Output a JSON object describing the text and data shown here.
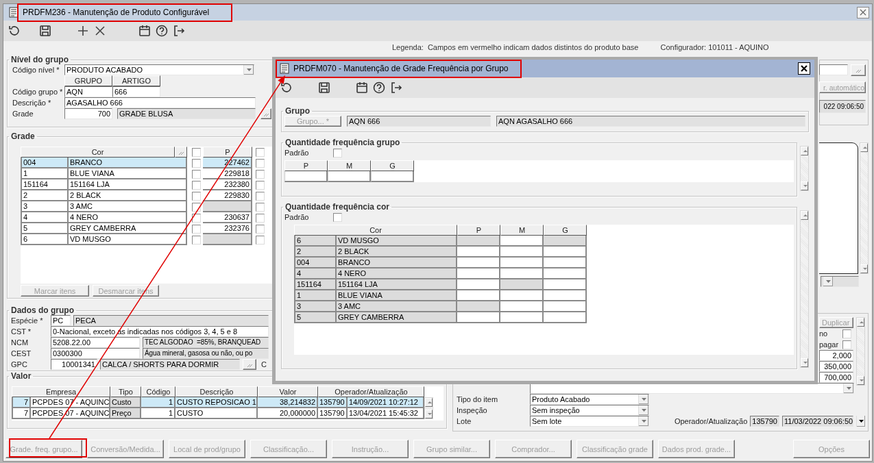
{
  "window": {
    "title": "PRDFM236 - Manutenção de Produto Configurável",
    "legend_label": "Legenda:",
    "legend_text": "Campos em vermelho indicam dados distintos do produto base",
    "configurador": "Configurador: 101011 - AQUINO",
    "nivel": {
      "title": "Nível do grupo",
      "codigo_nivel": {
        "label": "Código nível *",
        "value": "PRODUTO ACABADO"
      },
      "columns": [
        "GRUPO",
        "ARTIGO"
      ],
      "codigo_grupo": {
        "label": "Código grupo *",
        "grupo": "AQN",
        "artigo": "666"
      },
      "descricao": {
        "label": "Descrição *",
        "value": "AGASALHO 666"
      },
      "grade": {
        "label": "Grade",
        "code": "700",
        "name": "GRADE BLUSA"
      }
    },
    "nivel_side": {
      "button": {
        "label": "r. automático",
        "disabled": true
      },
      "date": "022 09:06:50"
    },
    "grade": {
      "title": "Grade",
      "columns": [
        "Cor",
        "P"
      ],
      "header_checked": [
        false,
        false
      ],
      "rows": [
        {
          "code": "004",
          "cor": "BRANCO",
          "checked": false,
          "p": "227462",
          "p_disabled": false,
          "checked_2": false,
          "selected": true
        },
        {
          "code": "1",
          "cor": "BLUE VIANA",
          "checked": false,
          "p": "229818",
          "p_disabled": false,
          "checked_2": false,
          "selected": false
        },
        {
          "code": "151164",
          "cor": "151164 LJA",
          "checked": false,
          "p": "232380",
          "p_disabled": false,
          "checked_2": false,
          "selected": false
        },
        {
          "code": "2",
          "cor": "2 BLACK",
          "checked": false,
          "p": "229830",
          "p_disabled": false,
          "checked_2": false,
          "selected": false
        },
        {
          "code": "3",
          "cor": "3 AMC",
          "checked": false,
          "p_disabled": true,
          "checked_2": false,
          "selected": false
        },
        {
          "code": "4",
          "cor": "4 NERO",
          "checked": false,
          "p": "230637",
          "p_disabled": false,
          "checked_2": false,
          "selected": false
        },
        {
          "code": "5",
          "cor": "GREY CAMBERRA",
          "checked": false,
          "p": "232376",
          "p_disabled": false,
          "checked_2": false,
          "selected": false
        },
        {
          "code": "6",
          "cor": "VD MUSGO",
          "checked": false,
          "p_disabled": true,
          "checked_2": false,
          "selected": false
        }
      ],
      "buttons": [
        {
          "label": "Marcar itens",
          "disabled": true
        },
        {
          "label": "Desmarcar itens",
          "disabled": true
        }
      ]
    },
    "dados": {
      "title": "Dados do grupo",
      "fields": [
        {
          "kind": "short",
          "label": "Espécie *",
          "code": "PC",
          "description": "PECA"
        },
        {
          "kind": "text",
          "label": "CST *",
          "description": "0-Nacional, exceto as indicadas nos códigos 3, 4, 5 e 8"
        },
        {
          "kind": "wide",
          "label": "NCM",
          "code": "5208.22.00",
          "description": "TEC ALGODAO  =85%, BRANQUEAD"
        },
        {
          "kind": "wide",
          "label": "CEST",
          "code": "0300300",
          "description": "Água mineral, gasosa ou não, ou po"
        },
        {
          "kind": "lookup",
          "label": "GPC",
          "code": "10001341",
          "description": "CALCA / SHORTS PARA DORMIR",
          "extra_label": "C"
        }
      ]
    },
    "valor": {
      "title": "Valor",
      "columns": [
        "Empresa",
        "Tipo",
        "Código",
        "Descrição",
        "Valor",
        "Operador/Atualização"
      ],
      "rows": [
        {
          "empresa_code": "7",
          "empresa": "PCPDES 07 - AQUINC",
          "tipo": "Custo",
          "codigo": "1",
          "descricao": "CUSTO REPOSICAO 1",
          "valor": "38,214832",
          "operador": "135790",
          "atualizacao": "14/09/2021 10:27:12",
          "selected": true
        },
        {
          "empresa_code": "7",
          "empresa": "PCPDES 07 - AQUINC",
          "tipo": "Preço",
          "codigo": "1",
          "descricao": "CUSTO",
          "valor": "20,000000",
          "operador": "135790",
          "atualizacao": "13/04/2021 15:45:32",
          "selected": false
        }
      ]
    },
    "item_panel": {
      "button": {
        "label": "Duplicar",
        "disabled": true
      },
      "checks": [
        {
          "label": "no",
          "checked": false
        },
        {
          "label": "pagar",
          "checked": false
        }
      ],
      "values": [
        "2,000",
        "350,000",
        "700,000"
      ],
      "selects": [
        {
          "label": "Tipo do item",
          "value": "Produto Acabado"
        },
        {
          "label": "Inspeção",
          "value": "Sem inspeção"
        },
        {
          "label": "Lote",
          "value": "Sem lote"
        }
      ],
      "operador": {
        "label": "Operador/Atualização",
        "code": "135790",
        "date": "11/03/2022 09:06:50"
      }
    },
    "buttons": [
      {
        "label": "Grade. freq. grupo...",
        "disabled": true
      },
      {
        "label": "Conversão/Medida...",
        "disabled": true
      },
      {
        "label": "Local de prod/grupo",
        "disabled": true
      },
      {
        "label": "Classificação...",
        "disabled": true
      },
      {
        "label": "Instrução...",
        "disabled": true
      },
      {
        "label": "Grupo similar...",
        "disabled": true
      },
      {
        "label": "Comprador...",
        "disabled": true
      },
      {
        "label": "Classificação grade",
        "disabled": true
      },
      {
        "label": "Dados prod. grade...",
        "disabled": true
      },
      {
        "label": "Opções",
        "disabled": true
      }
    ]
  },
  "dialog": {
    "title": "PRDFM070 - Manutenção de Grade Frequência por Grupo",
    "grupo": {
      "title": "Grupo",
      "button": {
        "label": "Grupo... *",
        "disabled": true
      },
      "code": "AQN 666",
      "name": "AQN AGASALHO 666"
    },
    "freq_grupo": {
      "title": "Quantidade frequência grupo",
      "padrao": {
        "label": "Padrão",
        "checked": false
      },
      "columns": [
        "P",
        "M",
        "G"
      ]
    },
    "freq_cor": {
      "title": "Quantidade frequência cor",
      "padrao": {
        "label": "Padrão",
        "checked": false
      },
      "columns": [
        "Cor",
        "P",
        "M",
        "G"
      ],
      "rows": [
        {
          "code": "6",
          "cor": "VD MUSGO",
          "sizes": [
            {
              "disabled": true
            },
            {
              "disabled": false
            },
            {
              "disabled": true
            }
          ]
        },
        {
          "code": "2",
          "cor": "2 BLACK",
          "sizes": [
            {
              "disabled": false
            },
            {
              "disabled": false
            },
            {
              "disabled": false
            }
          ]
        },
        {
          "code": "004",
          "cor": "BRANCO",
          "sizes": [
            {
              "disabled": false
            },
            {
              "disabled": false
            },
            {
              "disabled": false
            }
          ]
        },
        {
          "code": "4",
          "cor": "4 NERO",
          "sizes": [
            {
              "disabled": false
            },
            {
              "disabled": false
            },
            {
              "disabled": false
            }
          ]
        },
        {
          "code": "151164",
          "cor": "151164 LJA",
          "sizes": [
            {
              "disabled": false
            },
            {
              "disabled": true
            },
            {
              "disabled": false
            }
          ]
        },
        {
          "code": "1",
          "cor": "BLUE VIANA",
          "sizes": [
            {
              "disabled": false
            },
            {
              "disabled": false
            },
            {
              "disabled": false
            }
          ]
        },
        {
          "code": "3",
          "cor": "3 AMC",
          "sizes": [
            {
              "disabled": true
            },
            {
              "disabled": false
            },
            {
              "disabled": false
            }
          ]
        },
        {
          "code": "5",
          "cor": "GREY CAMBERRA",
          "sizes": [
            {
              "disabled": false
            },
            {
              "disabled": false
            },
            {
              "disabled": false
            }
          ]
        }
      ]
    }
  }
}
